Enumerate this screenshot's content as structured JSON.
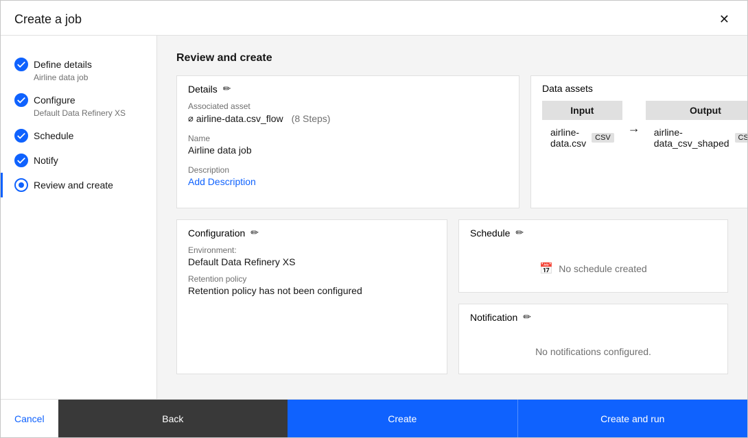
{
  "modal": {
    "title": "Create a job",
    "close_label": "✕"
  },
  "sidebar": {
    "items": [
      {
        "id": "define-details",
        "label": "Define details",
        "sublabel": "Airline data job",
        "state": "complete"
      },
      {
        "id": "configure",
        "label": "Configure",
        "sublabel": "Default Data Refinery XS",
        "state": "complete"
      },
      {
        "id": "schedule",
        "label": "Schedule",
        "sublabel": "",
        "state": "complete"
      },
      {
        "id": "notify",
        "label": "Notify",
        "sublabel": "",
        "state": "complete"
      },
      {
        "id": "review-create",
        "label": "Review and create",
        "sublabel": "",
        "state": "active"
      }
    ]
  },
  "main": {
    "section_title": "Review and create",
    "details_card": {
      "header": "Details",
      "associated_asset_label": "Associated asset",
      "associated_asset_value": "airline-data.csv_flow",
      "steps_badge": "(8 Steps)",
      "name_label": "Name",
      "name_value": "Airline data job",
      "description_label": "Description",
      "description_link": "Add Description"
    },
    "data_assets_card": {
      "header": "Data assets",
      "input_header": "Input",
      "input_filename": "airline-data.csv",
      "input_badge": "CSV",
      "output_header": "Output",
      "output_filename": "airline-data_csv_shaped",
      "output_badge": "CSV"
    },
    "configuration_card": {
      "header": "Configuration",
      "environment_label": "Environment:",
      "environment_value": "Default Data Refinery XS",
      "retention_label": "Retention policy",
      "retention_value": "Retention policy has not been configured"
    },
    "schedule_card": {
      "header": "Schedule",
      "empty_text": "No schedule created"
    },
    "notification_card": {
      "header": "Notification",
      "empty_text": "No notifications configured."
    }
  },
  "footer": {
    "cancel_label": "Cancel",
    "back_label": "Back",
    "create_label": "Create",
    "create_run_label": "Create and run"
  }
}
